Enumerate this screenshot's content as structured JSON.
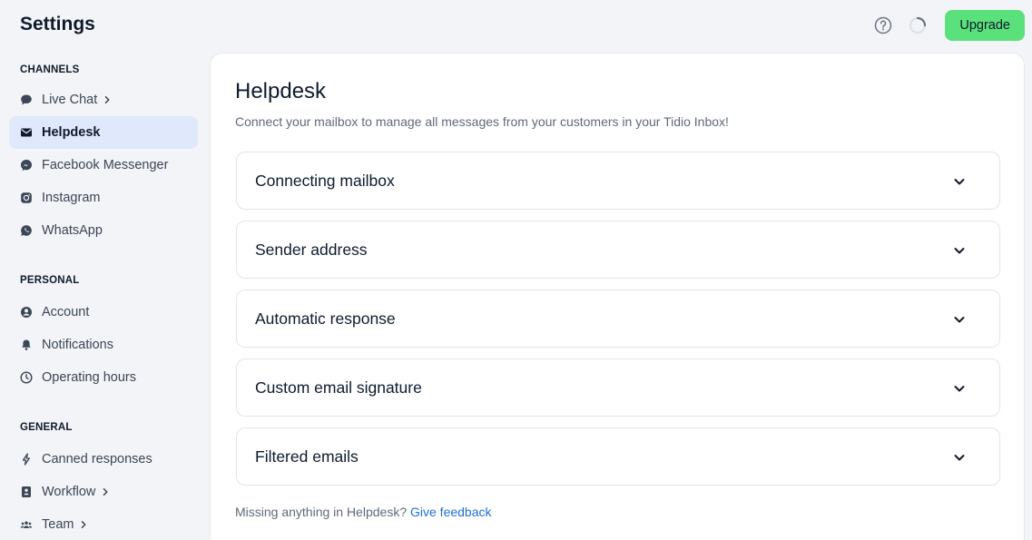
{
  "app": {
    "title": "Settings"
  },
  "topbar": {
    "help_icon": "question-circle-icon",
    "loading_icon": "spinner-icon",
    "upgrade_label": "Upgrade",
    "upgrade_color": "#5be17b"
  },
  "sidebar": {
    "sections": [
      {
        "header": "CHANNELS",
        "items": [
          {
            "label": "Live Chat",
            "icon": "chat-bubble-icon",
            "has_chevron": true,
            "active": false
          },
          {
            "label": "Helpdesk",
            "icon": "envelope-icon",
            "has_chevron": false,
            "active": true
          },
          {
            "label": "Facebook Messenger",
            "icon": "messenger-icon",
            "has_chevron": false,
            "active": false
          },
          {
            "label": "Instagram",
            "icon": "instagram-icon",
            "has_chevron": false,
            "active": false
          },
          {
            "label": "WhatsApp",
            "icon": "whatsapp-icon",
            "has_chevron": false,
            "active": false
          }
        ]
      },
      {
        "header": "PERSONAL",
        "items": [
          {
            "label": "Account",
            "icon": "user-circle-icon",
            "has_chevron": false,
            "active": false
          },
          {
            "label": "Notifications",
            "icon": "bell-icon",
            "has_chevron": false,
            "active": false
          },
          {
            "label": "Operating hours",
            "icon": "clock-icon",
            "has_chevron": false,
            "active": false
          }
        ]
      },
      {
        "header": "GENERAL",
        "items": [
          {
            "label": "Canned responses",
            "icon": "lightning-icon",
            "has_chevron": false,
            "active": false
          },
          {
            "label": "Workflow",
            "icon": "workflow-icon",
            "has_chevron": true,
            "active": false
          },
          {
            "label": "Team",
            "icon": "team-icon",
            "has_chevron": true,
            "active": false
          }
        ]
      }
    ]
  },
  "main": {
    "title": "Helpdesk",
    "subtitle": "Connect your mailbox to manage all messages from your customers in your Tidio Inbox!",
    "accordions": [
      {
        "label": "Connecting mailbox"
      },
      {
        "label": "Sender address"
      },
      {
        "label": "Automatic response"
      },
      {
        "label": "Custom email signature"
      },
      {
        "label": "Filtered emails"
      }
    ],
    "footer": {
      "text": "Missing anything in Helpdesk?",
      "link": "Give feedback"
    }
  },
  "colors": {
    "accent_link": "#1f6fd6",
    "active_nav_bg": "#dfe9fb",
    "page_bg": "#f3f4f7"
  }
}
